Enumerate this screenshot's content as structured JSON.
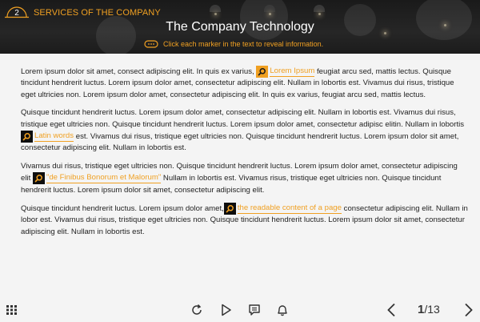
{
  "header": {
    "section_number": "2",
    "section_title": "SERVICES OF THE COMPANY",
    "page_title": "The Company Technology",
    "hint": "Click each marker in the text to reveal information."
  },
  "content": {
    "p1": {
      "t1": "Lorem ipsum dolor sit amet, consect adipiscing elit. In quis ex varius, ",
      "marker": "Lorem Ipsum",
      "t2": " feugiat arcu sed, mattis lectus. Quisque tincidunt hendrerit luctus. Lorem ipsum dolor amet, consectetur adipiscing elit. Nullam in lobortis est. Vivamus dui risus, tristique eget ultricies non. Lorem ipsum dolor amet, consectetur adipiscing elit. In quis ex varius, feugiat arcu sed, mattis lectus."
    },
    "p2": {
      "t1": "Quisque tincidunt hendrerit luctus. Lorem ipsum dolor amet, consectetur adipiscing elit. Nullam in lobortis est. Vivamus dui risus, tristique eget ultricies non. Quisque tincidunt hendrerit luctus. Lorem ipsum dolor amet, consectetur adipisc elitin. Nullam in lobortis ",
      "marker": "Latin words",
      "t2": " est. Vivamus dui risus, tristique eget ultricies non. Quisque tincidunt hendrerit luctus. Lorem ipsum dolor sit amet, consectetur adipiscing elit. Nullam in lobortis est."
    },
    "p3": {
      "t1": "Vivamus dui risus, tristique eget ultricies non. Quisque tincidunt hendrerit luctus. Lorem ipsum dolor amet, consectetur adipiscing elit ",
      "marker": "\"de Finibus Bonorum et Malorum\"",
      "t2": " Nullam in lobortis est. Vivamus risus, tristique eget ultricies non. Quisque tincidunt hendrerit luctus. Lorem ipsum dolor sit amet, consectetur adipiscing elit."
    },
    "p4": {
      "t1": "Quisque tincidunt hendrerit luctus. Lorem ipsum dolor amet,",
      "marker": "the readable content of a page",
      "t2": " consectetur adipiscing elit. Nullam in lobor est. Vivamus dui risus, tristique eget ultricies non. Quisque tincidunt hendrerit luctus. Lorem ipsum dolor sit amet, consectetur adipiscing elit. Nullam in lobortis est."
    }
  },
  "footer": {
    "current_page": "1",
    "total_pages": "/13"
  },
  "colors": {
    "accent": "#f0a022",
    "header_bg": "#1e1e1e",
    "body_bg": "#f4f4f4"
  },
  "icons": [
    "menu-grid-icon",
    "replay-icon",
    "play-icon",
    "comment-icon",
    "bell-icon",
    "chevron-left-icon",
    "chevron-right-icon",
    "magnifier-icon",
    "chat-bubble-icon"
  ]
}
